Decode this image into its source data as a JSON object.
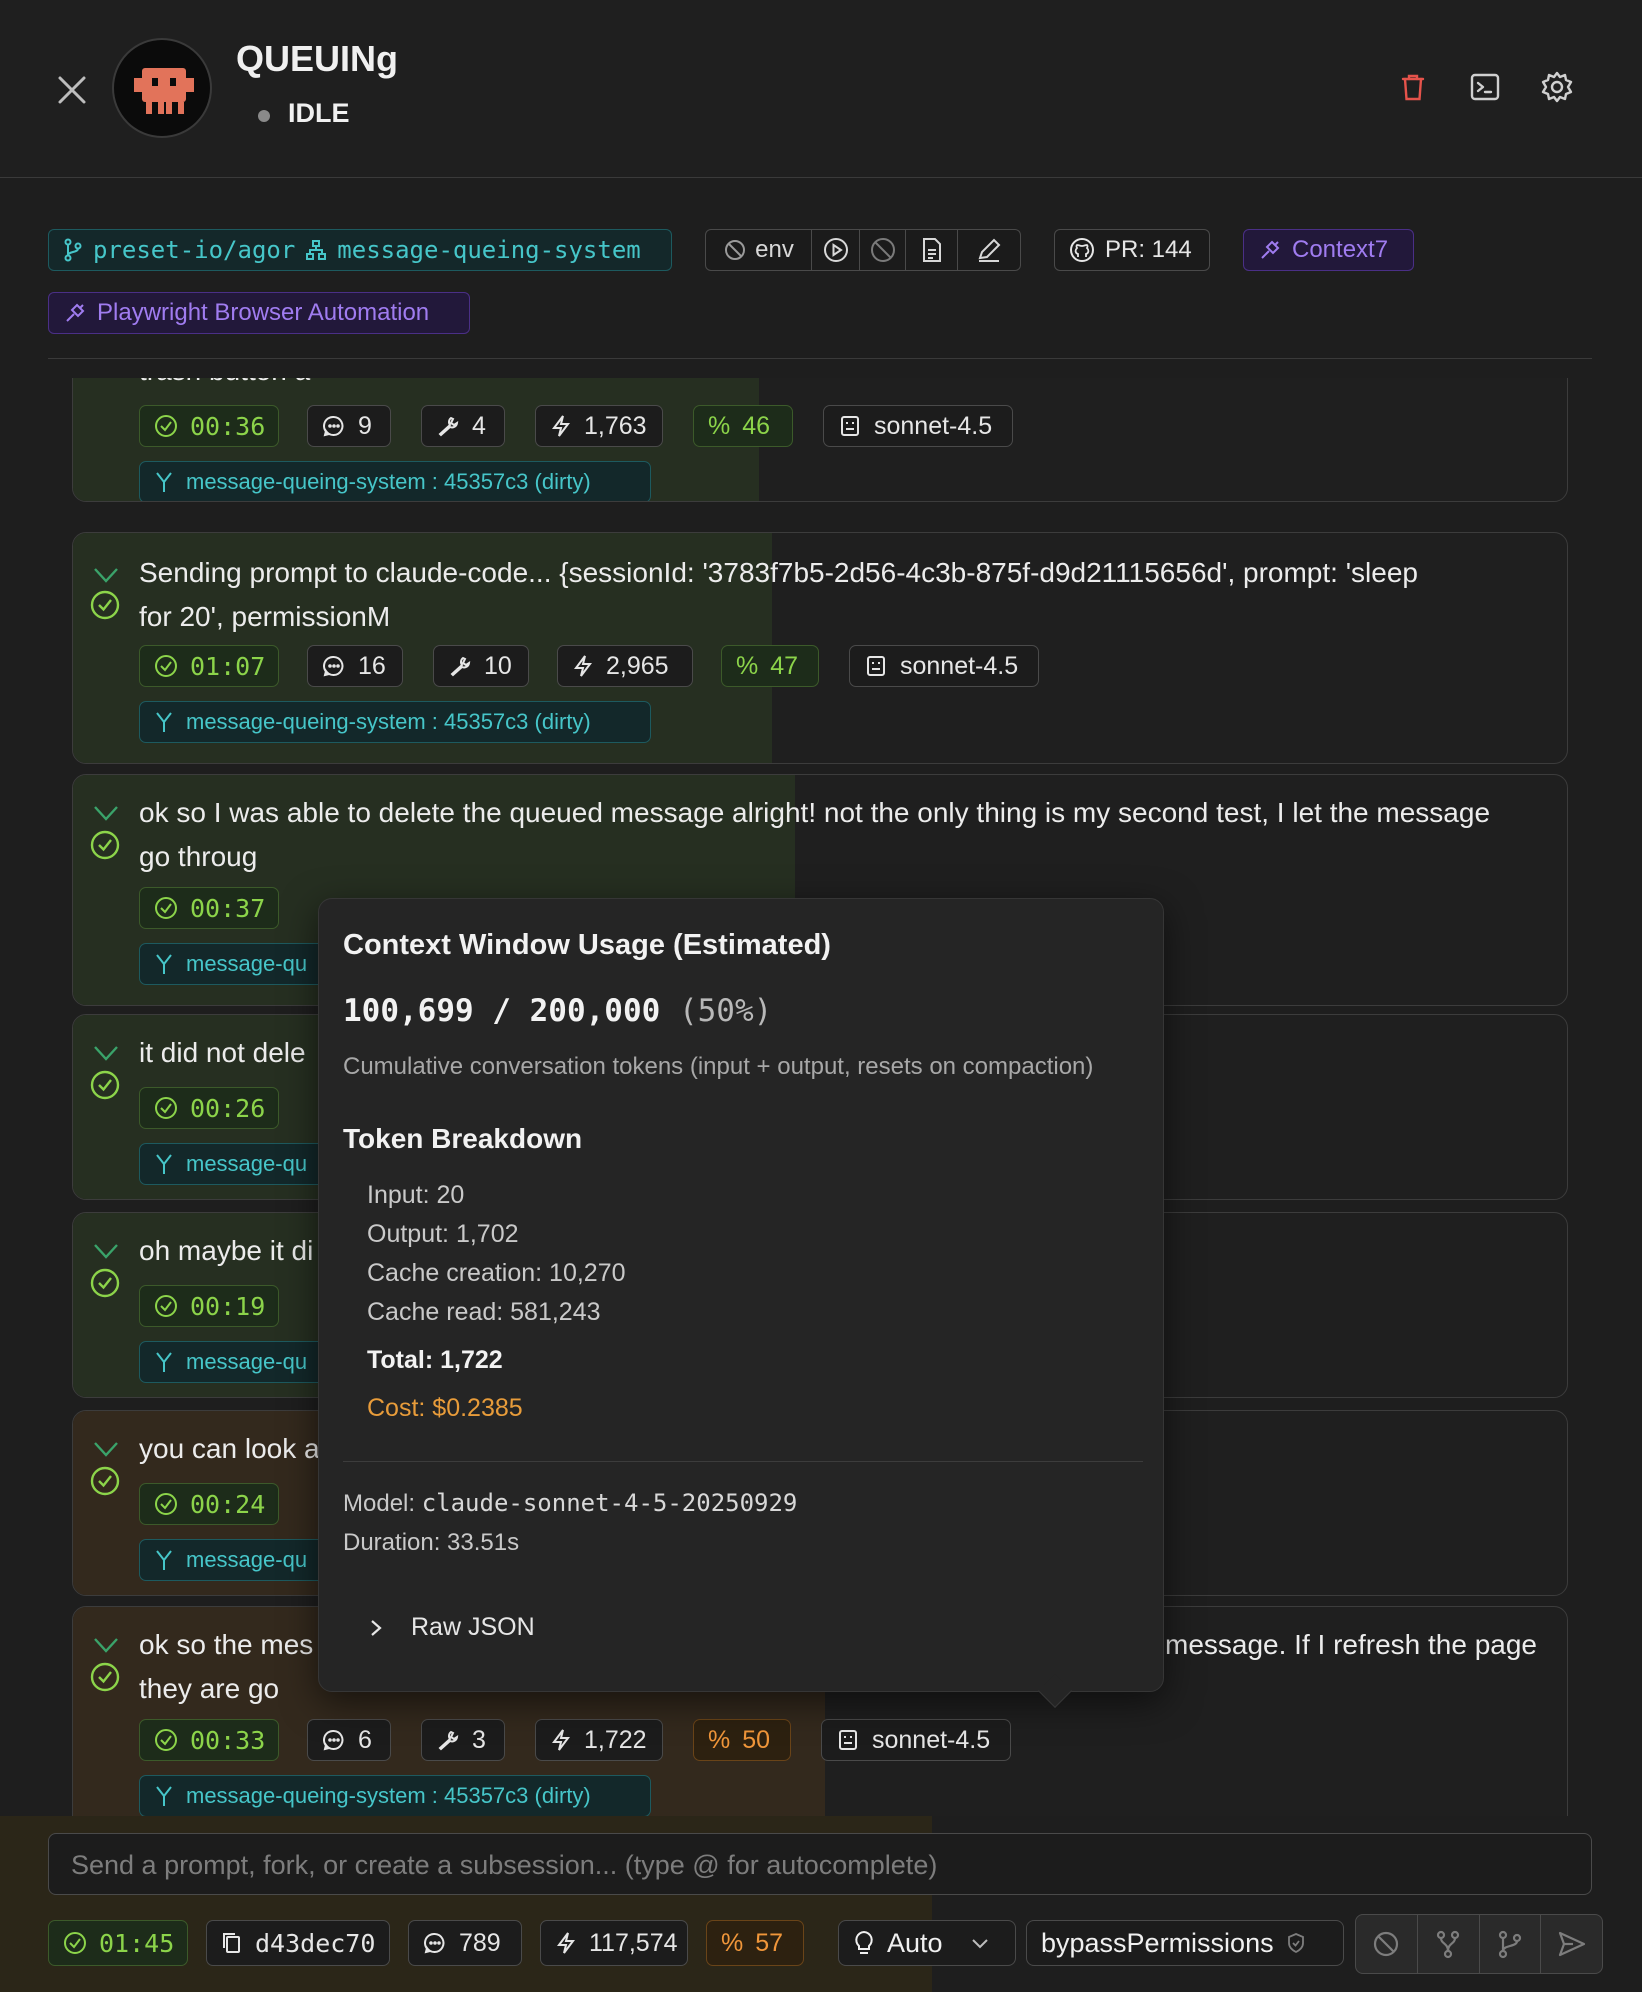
{
  "header": {
    "title": "QUEUINg",
    "status": "IDLE"
  },
  "tags": {
    "repo": "preset-io/agor",
    "worktree": "message-queing-system",
    "env": "env",
    "pr": "PR: 144",
    "mcp1": "Context7",
    "mcp2": "Playwright Browser Automation"
  },
  "messages": [
    {
      "text": "trash button a",
      "duration": "00:36",
      "messages": "9",
      "tools": "4",
      "tokens": "1,763",
      "context_pct": "46",
      "model": "sonnet-4.5",
      "branch": "message-queing-system : 45357c3 (dirty)"
    },
    {
      "text_line1": "Sending prompt to claude-code... {sessionId: '3783f7b5-2d56-4c3b-875f-d9d21115656d', prompt: 'sleep",
      "text_line2": "for 20', permissionM",
      "duration": "01:07",
      "messages": "16",
      "tools": "10",
      "tokens": "2,965",
      "context_pct": "47",
      "model": "sonnet-4.5",
      "branch": "message-queing-system : 45357c3 (dirty)"
    },
    {
      "text_line1": "ok so I was able to delete the queued message alright! not the only thing is my second test, I let the message",
      "text_line2": "go throug",
      "duration": "00:37",
      "branch_visible": "message-qu"
    },
    {
      "text": "it did not dele",
      "duration": "00:26",
      "branch_visible": "message-qu"
    },
    {
      "text": "oh maybe it di",
      "duration": "00:19",
      "branch_visible": "message-qu"
    },
    {
      "text": "you can look a",
      "duration": "00:24",
      "branch_visible": "message-qu"
    },
    {
      "text_line1_left": "ok so the mes",
      "text_line1_right": "message. If I refresh the page",
      "text_line2": "they are go",
      "duration": "00:33",
      "messages": "6",
      "tools": "3",
      "tokens": "1,722",
      "context_pct": "50",
      "model": "sonnet-4.5",
      "branch": "message-queing-system : 45357c3 (dirty)"
    }
  ],
  "tooltip": {
    "title": "Context Window Usage (Estimated)",
    "usage": "100,699 / 200,000",
    "usage_pct": "(50%)",
    "subtitle": "Cumulative conversation tokens (input + output, resets on compaction)",
    "breakdown_title": "Token Breakdown",
    "input": "Input: 20",
    "output": "Output: 1,702",
    "cache_creation": "Cache creation: 10,270",
    "cache_read": "Cache read: 581,243",
    "total": "Total: 1,722",
    "cost": "Cost: $0.2385",
    "model_label": "Model: ",
    "model_value": "claude-sonnet-4-5-20250929",
    "duration": "Duration: 33.51s",
    "raw_json": "Raw JSON"
  },
  "composer": {
    "placeholder": "Send a prompt, fork, or create a subsession... (type @ for autocomplete)"
  },
  "footer": {
    "duration": "01:45",
    "commit": "d43dec70",
    "messages": "789",
    "tokens": "117,574",
    "context_pct": "57",
    "mode": "Auto",
    "permission": "bypassPermissions"
  },
  "colors": {
    "accent_green": "#8cd44a",
    "accent_orange": "#f0963a",
    "accent_teal": "#46c6c9",
    "accent_purple": "#a07cf0",
    "danger_red": "#e5534b"
  }
}
